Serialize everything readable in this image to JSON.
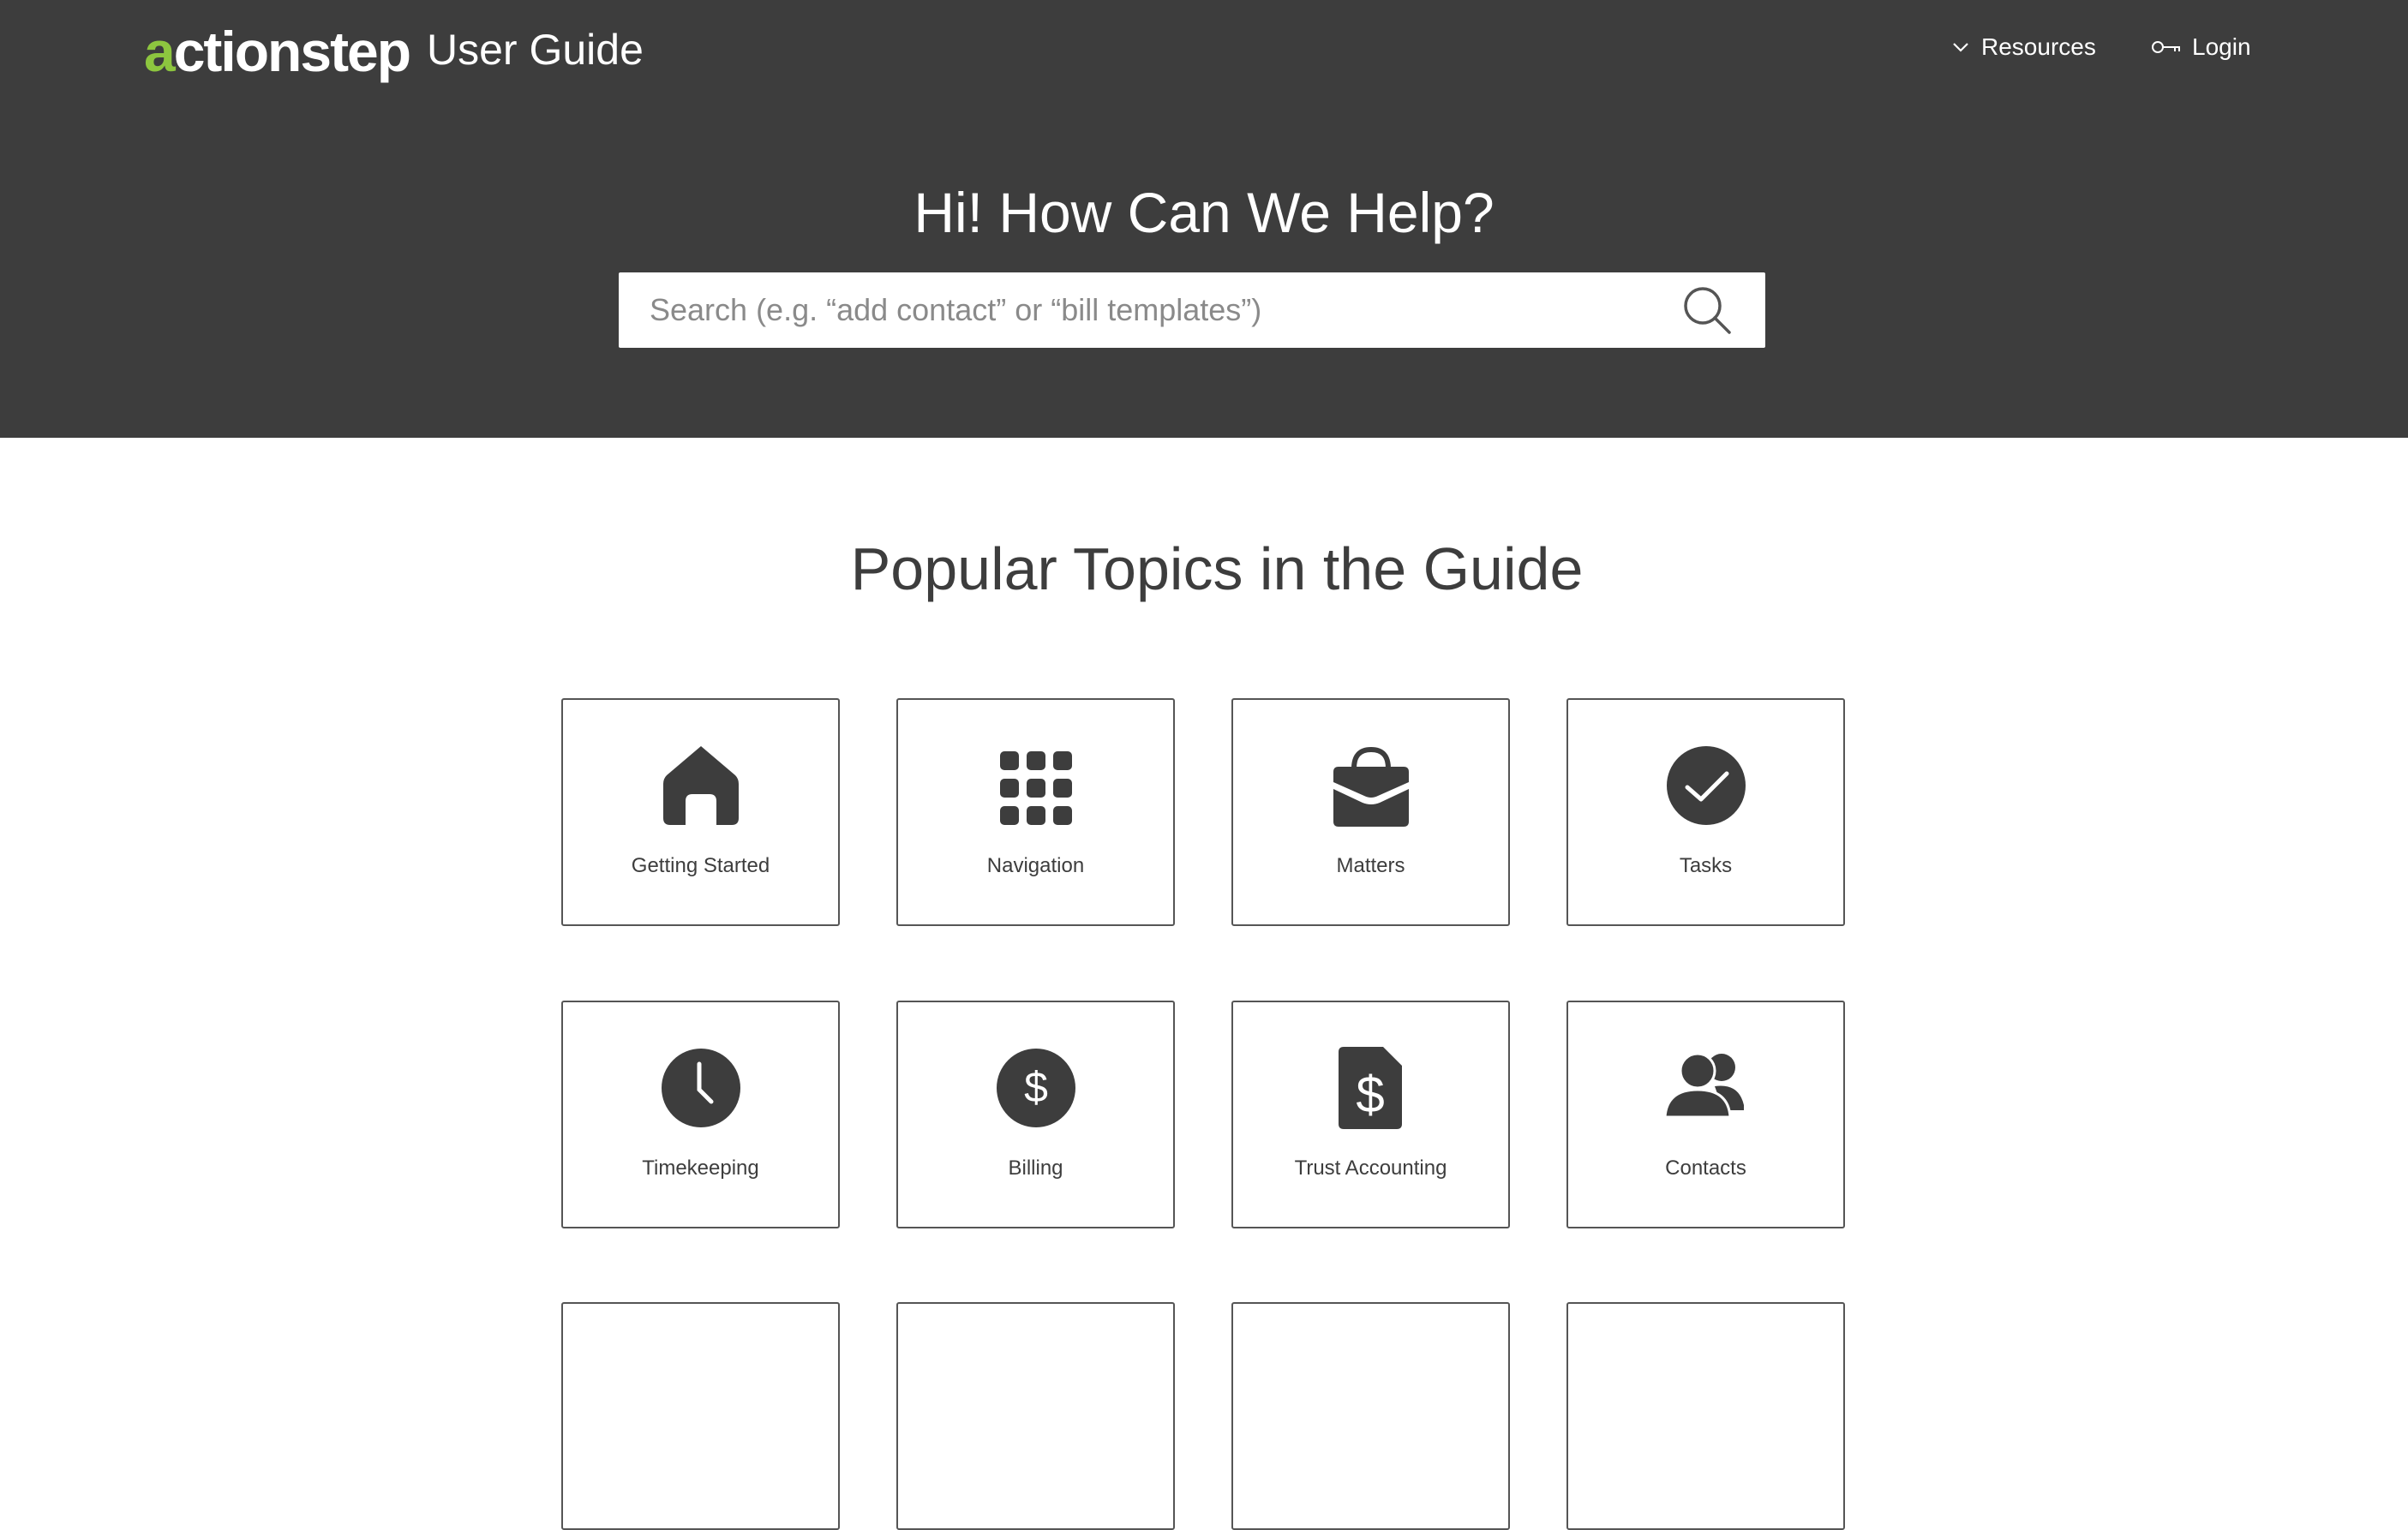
{
  "header": {
    "logo_prefix": "a",
    "logo_rest": "ctionstep",
    "title": "User Guide",
    "nav": {
      "resources_label": "Resources",
      "login_label": "Login"
    },
    "hero_title": "Hi! How Can We Help?",
    "search": {
      "placeholder": "Search (e.g. “add contact” or “bill templates”)",
      "value": ""
    }
  },
  "main": {
    "section_title": "Popular Topics in the Guide",
    "topics": [
      {
        "label": "Getting Started",
        "icon": "home-icon"
      },
      {
        "label": "Navigation",
        "icon": "grid-icon"
      },
      {
        "label": "Matters",
        "icon": "briefcase-icon"
      },
      {
        "label": "Tasks",
        "icon": "checkmark-circle-icon"
      },
      {
        "label": "Timekeeping",
        "icon": "clock-icon"
      },
      {
        "label": "Billing",
        "icon": "dollar-circle-icon"
      },
      {
        "label": "Trust Accounting",
        "icon": "dollar-document-icon"
      },
      {
        "label": "Contacts",
        "icon": "people-icon"
      }
    ]
  },
  "colors": {
    "header_bg": "#3d3d3d",
    "brand_green": "#8dc63f",
    "text_dark": "#3d3d3d",
    "card_border": "#555555"
  }
}
